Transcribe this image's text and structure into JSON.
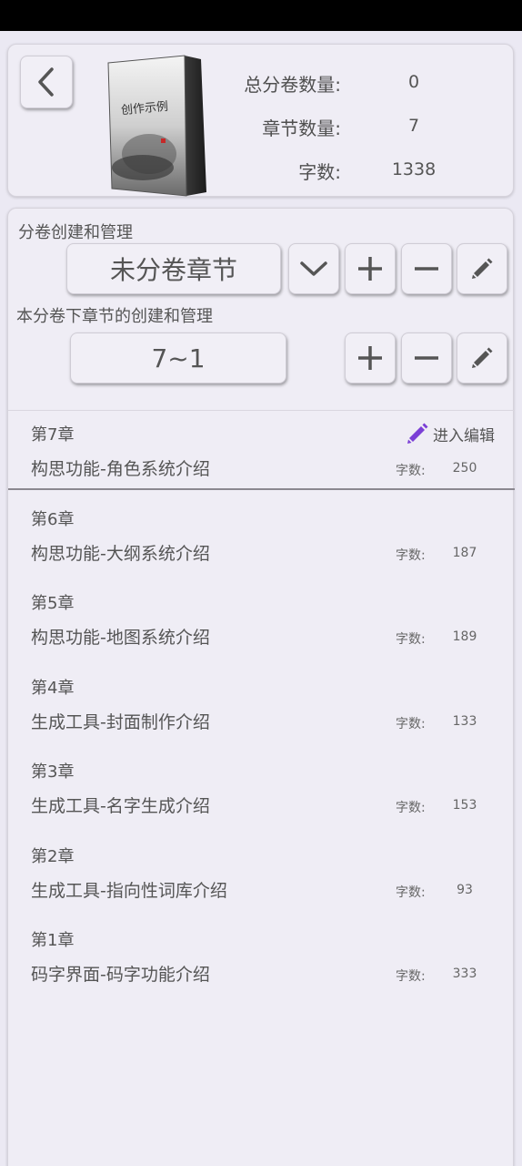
{
  "header": {
    "stats": [
      {
        "label": "总分卷数量:",
        "value": "0"
      },
      {
        "label": "章节数量:",
        "value": "7"
      },
      {
        "label": "字数:",
        "value": "1338"
      }
    ],
    "book_cover": {
      "title": "创作示例"
    }
  },
  "volume": {
    "section_label": "分卷创建和管理",
    "selected": "未分卷章节"
  },
  "chapters_mgmt": {
    "section_label": "本分卷下章节的创建和管理",
    "range": "7~1"
  },
  "chapter_list": {
    "edit_label": "进入编辑",
    "word_count_label": "字数:",
    "items": [
      {
        "no": "第7章",
        "title": "构思功能-角色系统介绍",
        "words": "250"
      },
      {
        "no": "第6章",
        "title": "构思功能-大纲系统介绍",
        "words": "187"
      },
      {
        "no": "第5章",
        "title": "构思功能-地图系统介绍",
        "words": "189"
      },
      {
        "no": "第4章",
        "title": "生成工具-封面制作介绍",
        "words": "133"
      },
      {
        "no": "第3章",
        "title": "生成工具-名字生成介绍",
        "words": "153"
      },
      {
        "no": "第2章",
        "title": "生成工具-指向性词库介绍",
        "words": "93"
      },
      {
        "no": "第1章",
        "title": "码字界面-码字功能介绍",
        "words": "333"
      }
    ]
  },
  "colors": {
    "background": "#ebe9f3",
    "edit_icon": "#7b3fd6"
  },
  "icons": [
    "chevron-left-icon",
    "chevron-down-icon",
    "plus-icon",
    "minus-icon",
    "pencil-icon"
  ]
}
